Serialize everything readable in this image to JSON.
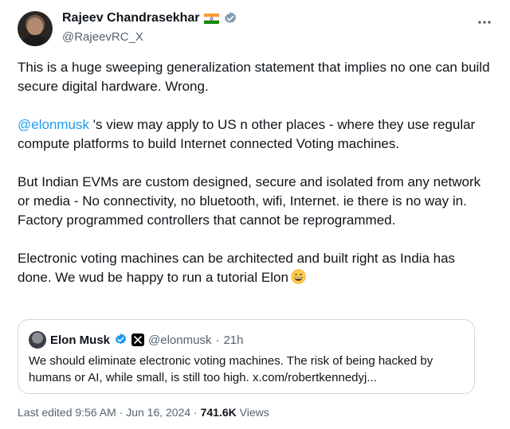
{
  "author": {
    "name": "Rajeev Chandrasekhar",
    "handle": "@RajeevRC_X"
  },
  "tweet": {
    "para1": "This is a huge sweeping generalization statement that implies no one can build  secure digital hardware. Wrong.",
    "para2_mention": "@elonmusk",
    "para2_rest": " 's view may apply to US n other places - where they use regular compute platforms to build Internet connected Voting machines.",
    "para3": "But Indian EVMs are custom designed,  secure and isolated from any network or media - No connectivity, no bluetooth, wifi, Internet. ie there is no way in. Factory programmed controllers that cannot be reprogrammed.",
    "para4": "Electronic voting machines can be architected and built right as India has done.  We wud be happy to run a tutorial Elon"
  },
  "quoted": {
    "name": "Elon Musk",
    "handle": "@elonmusk",
    "separator": "·",
    "time": "21h",
    "text": "We should eliminate electronic voting machines. The risk of being hacked by humans or AI, while small, is still too high. x.com/robertkennedyj..."
  },
  "footer": {
    "edited": "Last edited 9:56 AM · Jun 16, 2024 · ",
    "views_count": "741.6K",
    "views_label": " Views"
  },
  "icons": {
    "more": "more-options-icon",
    "verified": "verified-badge-icon",
    "flag": "india-flag-icon",
    "emoji": "grinning-emoji-icon",
    "x_badge": "x-logo-badge-icon"
  },
  "colors": {
    "link": "#1d9bf0",
    "verified": "#829aab",
    "muted": "#536471"
  }
}
